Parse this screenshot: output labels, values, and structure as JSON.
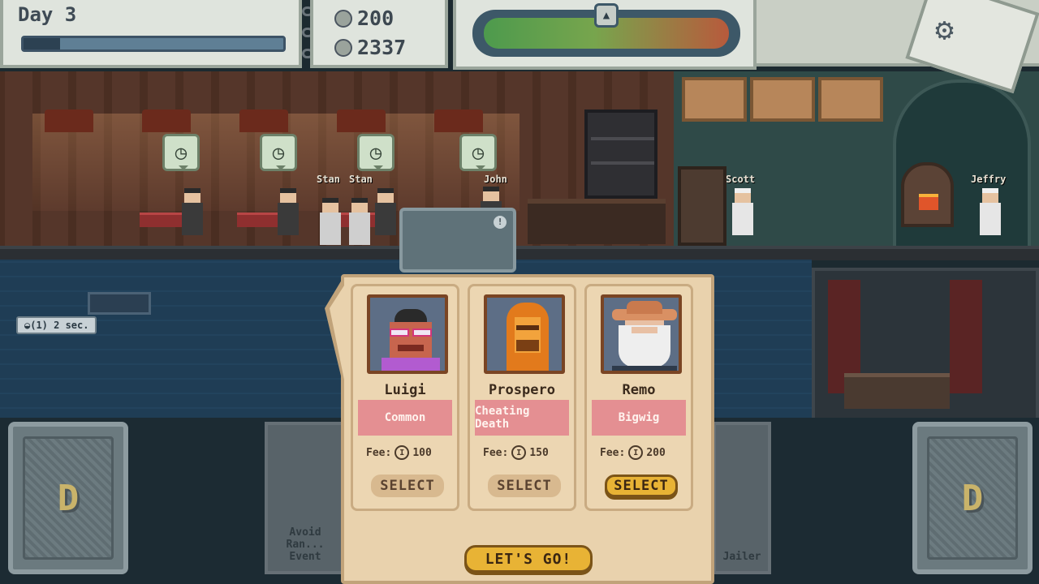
{
  "hud": {
    "day_label": "Day 3",
    "day_progress": 0.14,
    "currency_primary": "200",
    "currency_secondary": "2337",
    "heat_level": 1.0
  },
  "scene": {
    "npc_names": [
      "Stan",
      "Stan",
      "John",
      "Scott",
      "Jeffry"
    ],
    "status_timer": "◒(1) 2 sec."
  },
  "cards": {
    "left_faded_text": "Avoid Ran... Event",
    "right_faded_text": "Jailer",
    "emblem": "D"
  },
  "panel": {
    "fee_label": "Fee:",
    "select_label": "SELECT",
    "go_label": "LET'S GO!",
    "candidates": [
      {
        "name": "Luigi",
        "trait": "Common",
        "fee": "100",
        "selected": false
      },
      {
        "name": "Prospero",
        "trait": "Cheating Death",
        "fee": "150",
        "selected": false
      },
      {
        "name": "Remo",
        "trait": "Bigwig",
        "fee": "200",
        "selected": true
      }
    ]
  },
  "colors": {
    "accent_gold": "#e8b335",
    "trait_pink": "#e48f92",
    "panel_tan": "#e9d2ad"
  }
}
